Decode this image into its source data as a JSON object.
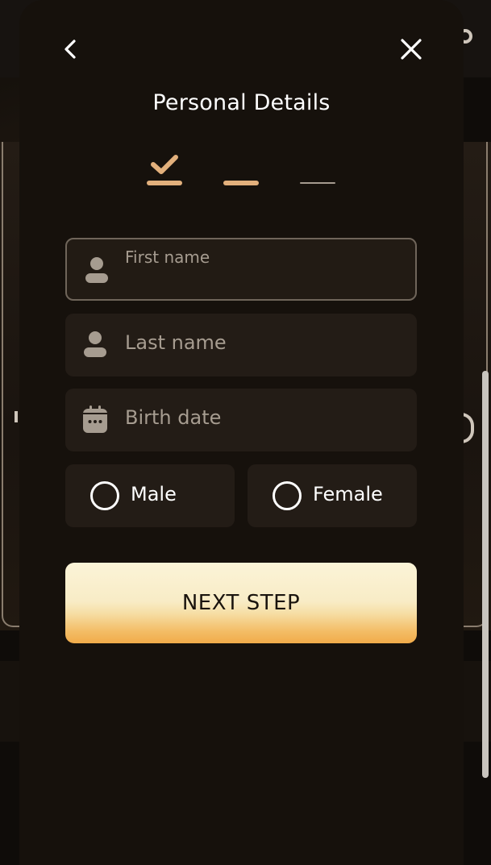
{
  "icons": {
    "back": "chevron-left-icon",
    "close": "close-icon",
    "step_done": "checkmark-icon",
    "person": "person-icon",
    "calendar": "calendar-icon"
  },
  "colors": {
    "sheet_background": "#16110c",
    "field_background": "#231c16",
    "step_accent": "#e2b07c",
    "button_gradient_top": "#fbf4d8",
    "button_gradient_bottom": "#f1ab4a",
    "placeholder_text": "#a69c90"
  },
  "header": {
    "title": "Personal Details"
  },
  "steps": [
    {
      "state": "completed"
    },
    {
      "state": "current"
    },
    {
      "state": "upcoming"
    }
  ],
  "form": {
    "first_name": {
      "placeholder": "First name",
      "value": "",
      "focused": true
    },
    "last_name": {
      "placeholder": "Last name",
      "value": ""
    },
    "birth_date": {
      "placeholder": "Birth date",
      "value": ""
    },
    "gender": {
      "options": [
        {
          "label": "Male",
          "selected": false
        },
        {
          "label": "Female",
          "selected": false
        }
      ]
    }
  },
  "actions": {
    "next_label": "NEXT STEP"
  }
}
